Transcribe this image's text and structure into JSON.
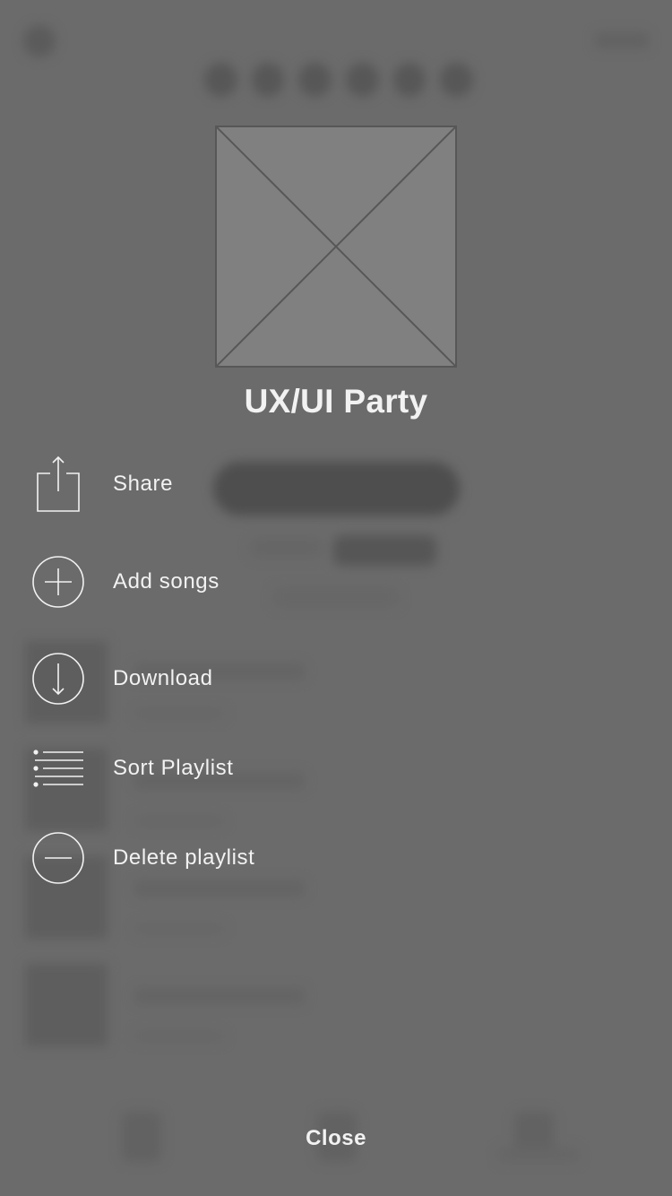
{
  "colors": {
    "overlay_background": "#6b6b6b",
    "foreground_text": "#f2f2f2",
    "cover_fill": "#808080",
    "cover_stroke": "#575757"
  },
  "playlist": {
    "title": "UX/UI Party"
  },
  "menu": {
    "items": [
      {
        "label": "Share",
        "icon": "share-icon"
      },
      {
        "label": "Add songs",
        "icon": "plus-circle-icon"
      },
      {
        "label": "Download",
        "icon": "download-circle-icon"
      },
      {
        "label": "Sort Playlist",
        "icon": "list-icon"
      },
      {
        "label": "Delete playlist",
        "icon": "minus-circle-icon"
      }
    ]
  },
  "footer": {
    "close_label": "Close"
  }
}
